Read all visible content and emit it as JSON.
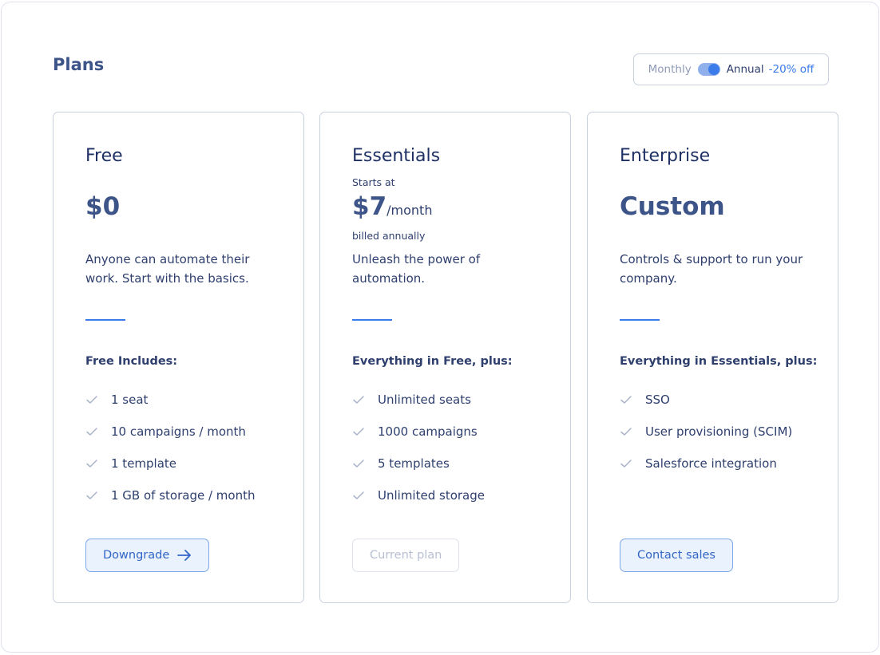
{
  "page": {
    "title": "Plans"
  },
  "billing_toggle": {
    "monthly_label": "Monthly",
    "annual_label": "Annual",
    "discount_label": "-20% off",
    "selected": "Annual"
  },
  "plans": [
    {
      "name": "Free",
      "starts_at": "",
      "price": "$0",
      "price_unit": "",
      "billed": "",
      "description": "Anyone can automate their work. Start with the basics.",
      "includes_heading": "Free Includes:",
      "features": [
        "1 seat",
        "10 campaigns / month",
        "1 template",
        "1 GB of storage / month"
      ],
      "action_label": "Downgrade"
    },
    {
      "name": "Essentials",
      "starts_at": "Starts at",
      "price": "$7",
      "price_unit": "/month",
      "billed": "billed annually",
      "description": "Unleash the power of automation.",
      "includes_heading": "Everything in Free, plus:",
      "features": [
        "Unlimited seats",
        "1000 campaigns",
        "5 templates",
        "Unlimited storage"
      ],
      "action_label": "Current plan"
    },
    {
      "name": "Enterprise",
      "starts_at": "",
      "price": "Custom",
      "price_unit": "",
      "billed": "",
      "description": "Controls & support to run your company.",
      "includes_heading": "Everything in Essentials, plus:",
      "features": [
        "SSO",
        "User provisioning (SCIM)",
        "Salesforce integration"
      ],
      "action_label": "Contact sales"
    }
  ],
  "colors": {
    "accent": "#3b7bea",
    "heading": "#3d5488",
    "text": "#2e3f6e",
    "border": "#c9d0de"
  },
  "icons": {
    "feature": "check-icon",
    "downgrade": "arrow-right-icon"
  }
}
